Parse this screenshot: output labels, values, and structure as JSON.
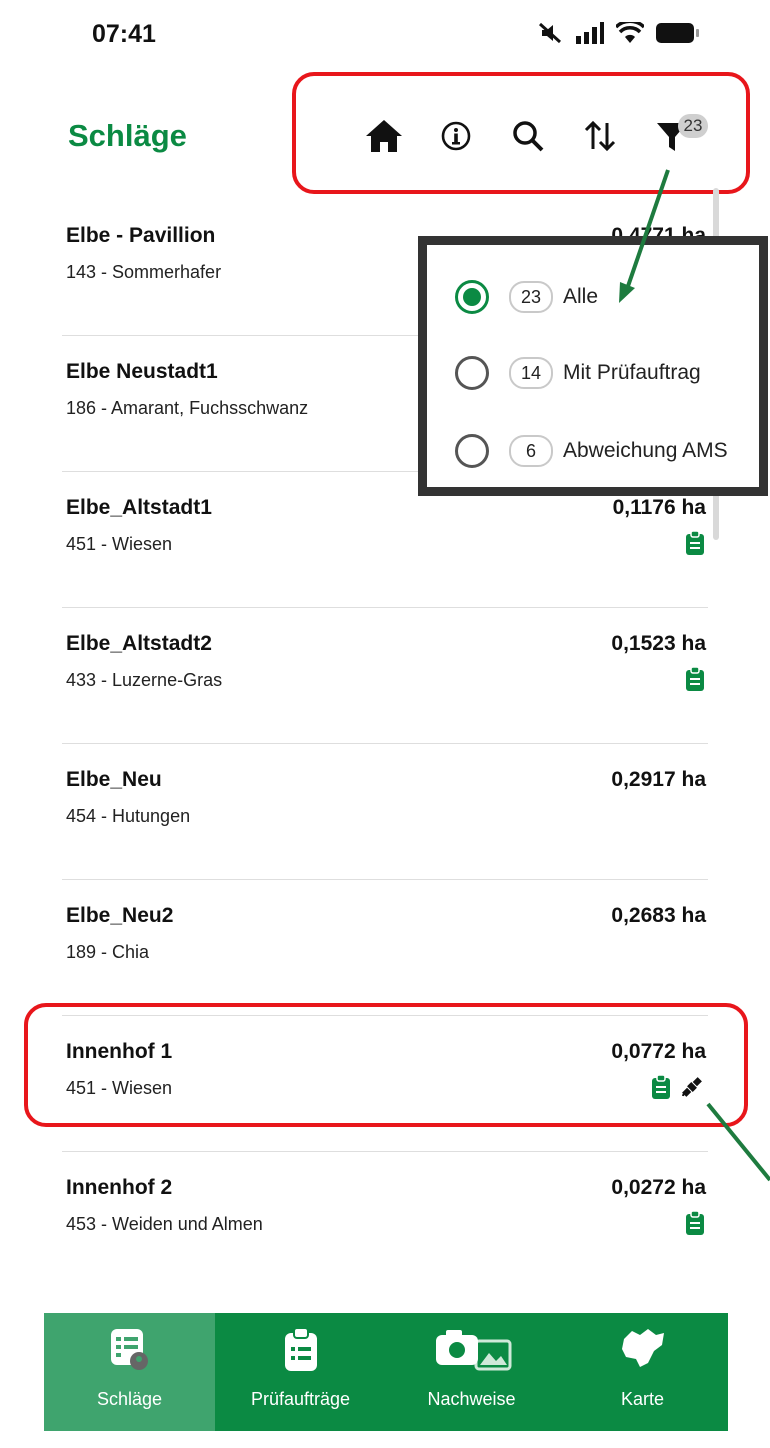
{
  "status_bar": {
    "time": "07:41"
  },
  "header": {
    "title": "Schläge",
    "toolbar": {
      "home_icon": "home-icon",
      "info_icon": "info-icon",
      "search_icon": "search-icon",
      "sort_icon": "sort-icon",
      "filter_icon": "filter-icon",
      "filter_count": "23"
    }
  },
  "fields": [
    {
      "name": "Elbe - Pavillion",
      "crop": "143 - Sommerhafer",
      "area": "0,4771 ha",
      "icons": []
    },
    {
      "name": "Elbe Neustadt1",
      "crop": "186 - Amarant, Fuchsschwanz",
      "area": "",
      "icons": []
    },
    {
      "name": "Elbe_Altstadt1",
      "crop": "451 - Wiesen",
      "area": "0,1176 ha",
      "icons": [
        "clipboard-icon"
      ]
    },
    {
      "name": "Elbe_Altstadt2",
      "crop": "433 - Luzerne-Gras",
      "area": "0,1523 ha",
      "icons": [
        "clipboard-icon"
      ]
    },
    {
      "name": "Elbe_Neu",
      "crop": "454 - Hutungen",
      "area": "0,2917 ha",
      "icons": []
    },
    {
      "name": "Elbe_Neu2",
      "crop": "189 - Chia",
      "area": "0,2683 ha",
      "icons": []
    },
    {
      "name": "Innenhof 1",
      "crop": "451 - Wiesen",
      "area": "0,0772 ha",
      "icons": [
        "clipboard-icon",
        "satellite-icon"
      ]
    },
    {
      "name": "Innenhof 2",
      "crop": "453 - Weiden und Almen",
      "area": "0,0272 ha",
      "icons": [
        "clipboard-icon"
      ]
    }
  ],
  "filter_menu": {
    "options": [
      {
        "count": "23",
        "label": "Alle",
        "selected": true
      },
      {
        "count": "14",
        "label": "Mit Prüfauftrag",
        "selected": false
      },
      {
        "count": "6",
        "label": "Abweichung AMS",
        "selected": false
      }
    ]
  },
  "bottom_nav": {
    "tabs": [
      {
        "label": "Schläge",
        "icon": "field-list-icon",
        "active": true
      },
      {
        "label": "Prüfaufträge",
        "icon": "clipboard-list-icon",
        "active": false
      },
      {
        "label": "Nachweise",
        "icon": "camera-gallery-icon",
        "active": false
      },
      {
        "label": "Karte",
        "icon": "map-icon",
        "active": false
      }
    ]
  },
  "colors": {
    "brand_green": "#0b8a43",
    "active_tab": "#3fa46e",
    "annotation_red": "#e8161b"
  }
}
